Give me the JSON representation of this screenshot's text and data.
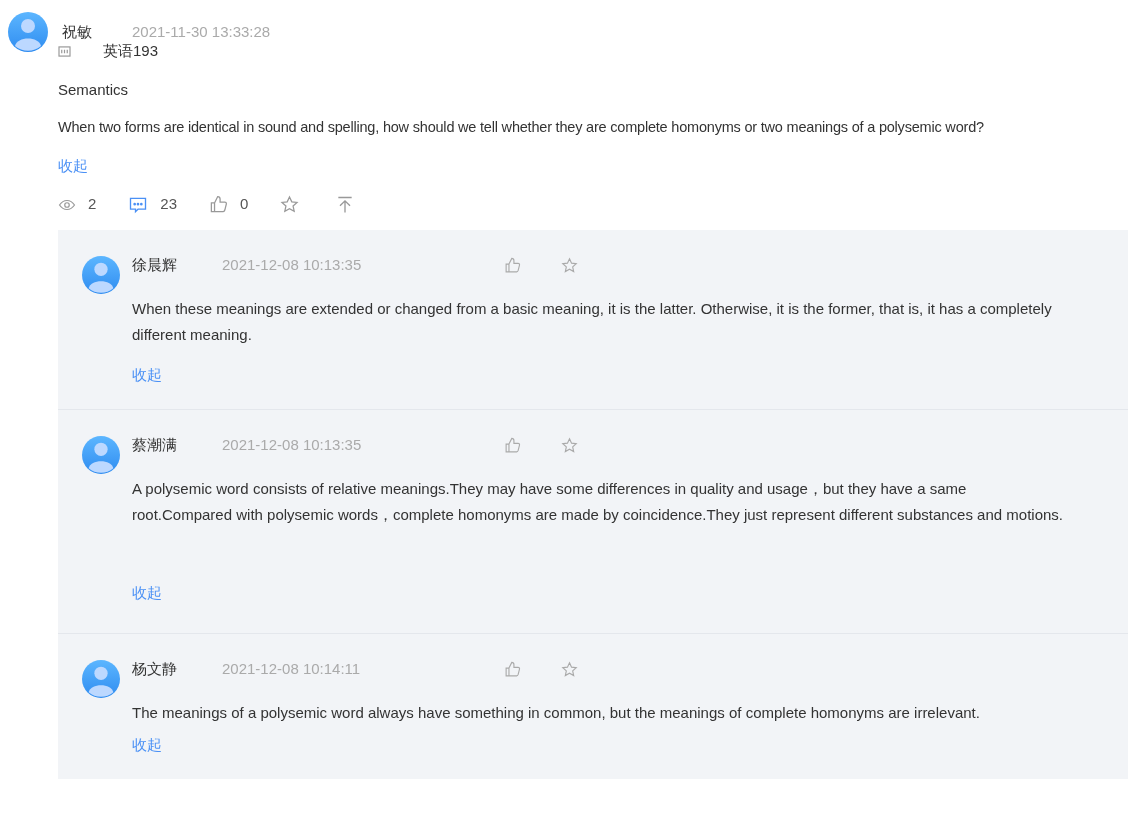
{
  "post": {
    "author": "祝敏",
    "time": "2021-11-30 13:33:28",
    "course": "英语193",
    "title": "Semantics",
    "body": "When two forms are identical in sound and spelling, how should we tell whether they are  complete homonyms or two meanings of a polysemic word?",
    "collapse": "收起",
    "views": "2",
    "comments": "23",
    "likes": "0"
  },
  "replies": [
    {
      "author": "徐晨辉",
      "time": "2021-12-08 10:13:35",
      "body": "When these meanings are extended or changed from a basic meaning, it is the latter. Otherwise, it is the former, that is, it has a completely different meaning.",
      "collapse": "收起"
    },
    {
      "author": "蔡潮满",
      "time": "2021-12-08 10:13:35",
      "body": "A polysemic word consists of relative meanings.They may have some differences in quality and usage，but they have a same root.Compared with polysemic words，complete homonyms are made by coincidence.They just represent different substances and motions.",
      "collapse": "收起"
    },
    {
      "author": "杨文静",
      "time": "2021-12-08 10:14:11",
      "body": "The meanings of a polysemic word always have something in common, but the meanings of complete homonyms are irrelevant.",
      "collapse": "收起"
    }
  ]
}
